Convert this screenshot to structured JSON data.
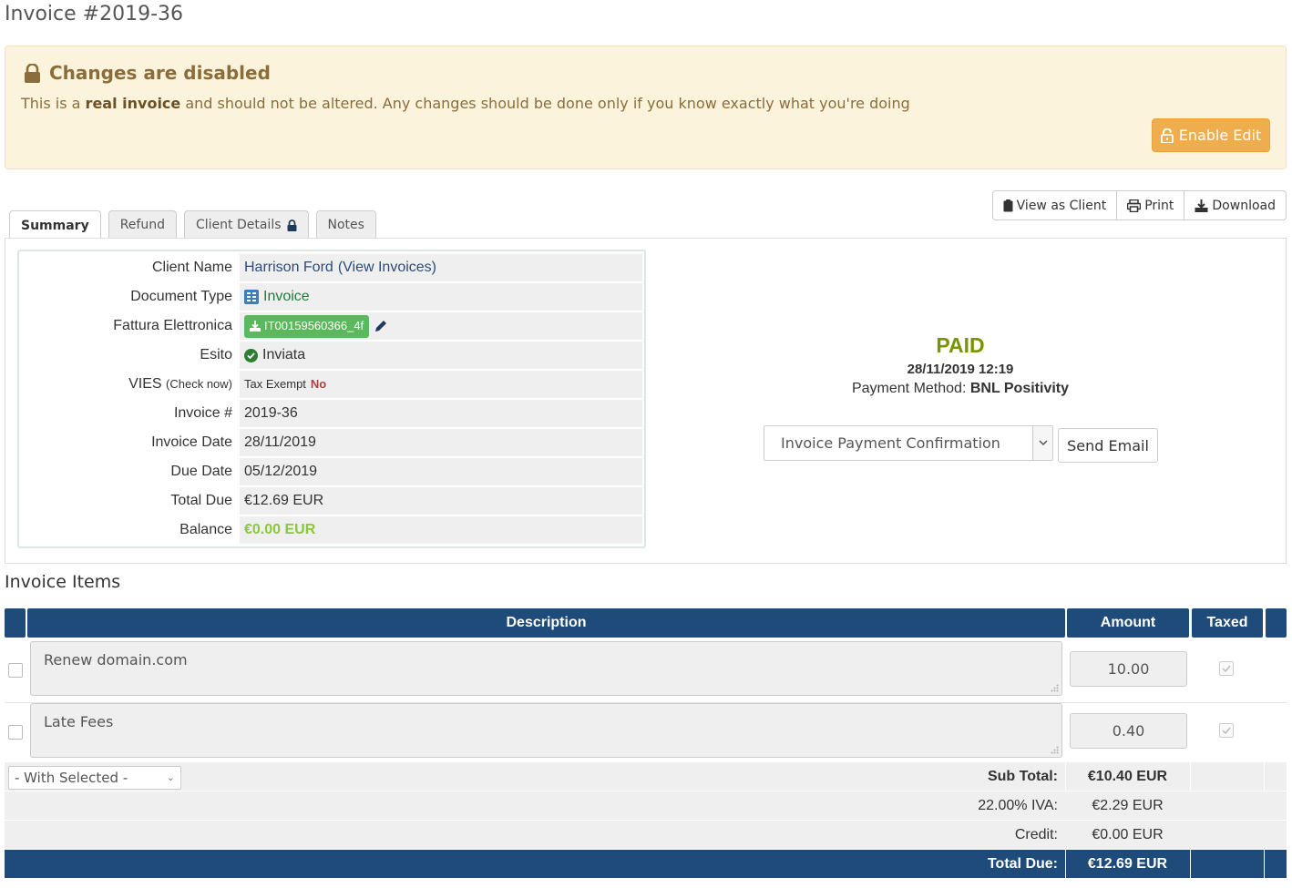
{
  "page": {
    "title": "Invoice #2019-36"
  },
  "warning": {
    "title": "Changes are disabled",
    "text_before": "This is a ",
    "text_bold": "real invoice",
    "text_after": " and should not be altered. Any changes should be done only if you know exactly what you're doing",
    "enable_edit_label": "Enable Edit"
  },
  "actions": {
    "view_as_client": "View as Client",
    "print": "Print",
    "download": "Download"
  },
  "tabs": [
    {
      "label": "Summary"
    },
    {
      "label": "Refund"
    },
    {
      "label": "Client Details"
    },
    {
      "label": "Notes"
    }
  ],
  "summary": {
    "client_name_label": "Client Name",
    "client_name": "Harrison Ford",
    "view_invoices": "(View Invoices)",
    "document_type_label": "Document Type",
    "document_type": "Invoice",
    "fattura_label": "Fattura Elettronica",
    "fattura_value": "IT00159560366_4f",
    "esito_label": "Esito",
    "esito_value": "Inviata",
    "vies_label": "VIES",
    "vies_check": "(Check now)",
    "tax_exempt_label": "Tax Exempt",
    "tax_exempt_value": "No",
    "invoice_num_label": "Invoice #",
    "invoice_num": "2019-36",
    "invoice_date_label": "Invoice Date",
    "invoice_date": "28/11/2019",
    "due_date_label": "Due Date",
    "due_date": "05/12/2019",
    "total_due_label": "Total Due",
    "total_due": "€12.69 EUR",
    "balance_label": "Balance",
    "balance": "€0.00 EUR"
  },
  "status": {
    "label": "PAID",
    "date": "28/11/2019 12:19",
    "payment_method_label": "Payment Method:",
    "payment_method": "BNL Positivity",
    "email_template": "Invoice Payment Confirmation",
    "send_email_label": "Send Email"
  },
  "items": {
    "title": "Invoice Items",
    "headers": {
      "description": "Description",
      "amount": "Amount",
      "taxed": "Taxed"
    },
    "rows": [
      {
        "description": "Renew domain.com",
        "amount": "10.00",
        "taxed": true
      },
      {
        "description": "Late Fees",
        "amount": "0.40",
        "taxed": true
      }
    ],
    "with_selected": "- With Selected -"
  },
  "totals": {
    "sub_total_label": "Sub Total:",
    "sub_total": "€10.40 EUR",
    "iva_label": "22.00% IVA:",
    "iva": "€2.29 EUR",
    "credit_label": "Credit:",
    "credit": "€0.00 EUR",
    "total_due_label": "Total Due:",
    "total_due": "€12.69 EUR"
  },
  "colors": {
    "header_blue": "#1e4b7a",
    "paid_green": "#779500",
    "warning_bg": "#fcf3dc",
    "enable_edit_orange": "#f0ad4e"
  }
}
